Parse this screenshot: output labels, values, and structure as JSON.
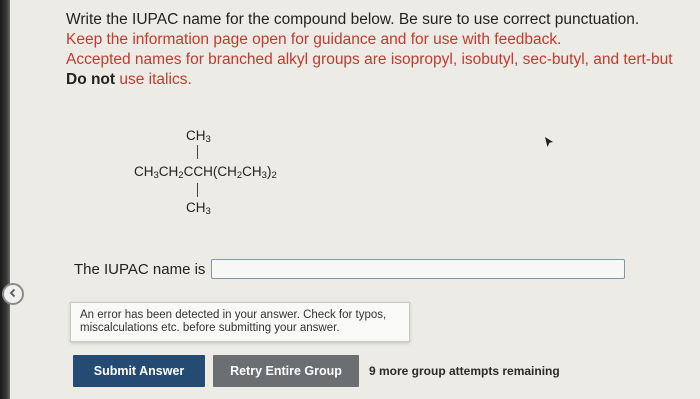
{
  "instructions": {
    "line1": "Write the IUPAC name for the compound below. Be sure to use correct punctuation.",
    "line2": "Keep the information page open for guidance and for use with feedback.",
    "line3": "Accepted names for branched alkyl groups are isopropyl, isobutyl, sec-butyl, and tert-but",
    "line4_bold": "Do not",
    "line4_rest": " use italics."
  },
  "structure": {
    "top_substituent": "CH3",
    "main_chain": "CH3CH2CCH(CH2CH3)2",
    "bottom_substituent": "CH3"
  },
  "answer": {
    "label": "The IUPAC name is",
    "value": "",
    "placeholder": ""
  },
  "feedback": {
    "error_message": "An error has been detected in your answer. Check for typos, miscalculations etc. before submitting your answer."
  },
  "actions": {
    "submit_label": "Submit Answer",
    "retry_label": "Retry Entire Group",
    "attempts_text": "9 more group attempts remaining"
  },
  "colors": {
    "accent_red": "#c33b2c",
    "submit_bg": "#244b73",
    "retry_bg": "#6b6f72",
    "page_bg": "#ecebe6"
  },
  "icons": {
    "back_tab": "chevron-left-icon",
    "cursor": "mouse-pointer-icon"
  }
}
